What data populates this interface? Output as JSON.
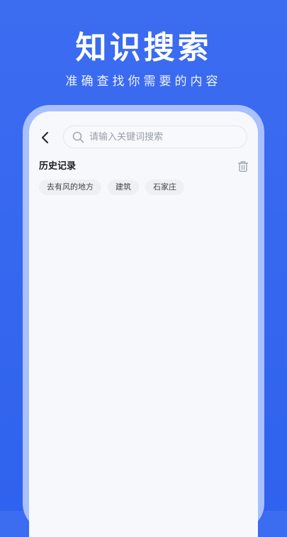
{
  "banner": {
    "title": "知识搜索",
    "subtitle": "准确查找你需要的内容"
  },
  "search": {
    "placeholder": "请输入关键词搜索",
    "value": ""
  },
  "history": {
    "title": "历史记录",
    "items": [
      "去有风的地方",
      "建筑",
      "石家庄"
    ]
  },
  "icons": {
    "back": "chevron-left-icon",
    "search": "search-icon",
    "delete": "trash-icon"
  },
  "colors": {
    "background": "#3c6cf0",
    "frame": "#a9c0ff",
    "screen": "#f6f8fc"
  }
}
